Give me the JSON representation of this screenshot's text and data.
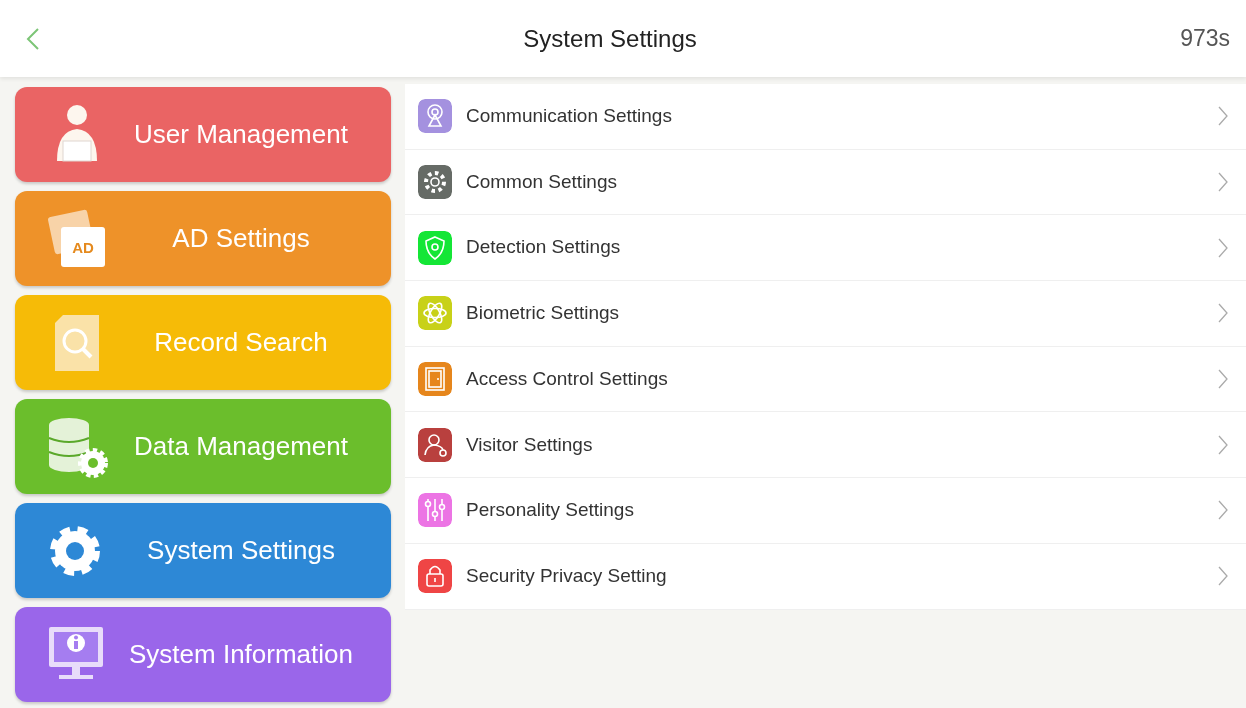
{
  "header": {
    "title": "System Settings",
    "countdown": "973s"
  },
  "menu": [
    {
      "label": "User Management",
      "color": "#ea6464"
    },
    {
      "label": "AD Settings",
      "color": "#ee9229",
      "icon_text": "AD"
    },
    {
      "label": "Record Search",
      "color": "#f6bb07"
    },
    {
      "label": "Data Management",
      "color": "#6bbe2c"
    },
    {
      "label": "System Settings",
      "color": "#2d88d6"
    },
    {
      "label": "System Information",
      "color": "#9a66ea"
    }
  ],
  "settings": [
    {
      "label": "Communication Settings",
      "color": "#a491df"
    },
    {
      "label": "Common Settings",
      "color": "#666b66"
    },
    {
      "label": "Detection Settings",
      "color": "#14e636"
    },
    {
      "label": "Biometric Settings",
      "color": "#c8d118"
    },
    {
      "label": "Access Control Settings",
      "color": "#e6861c"
    },
    {
      "label": "Visitor Settings",
      "color": "#b9403e"
    },
    {
      "label": "Personality Settings",
      "color": "#ec74e4"
    },
    {
      "label": "Security Privacy Setting",
      "color": "#ef4545"
    }
  ]
}
